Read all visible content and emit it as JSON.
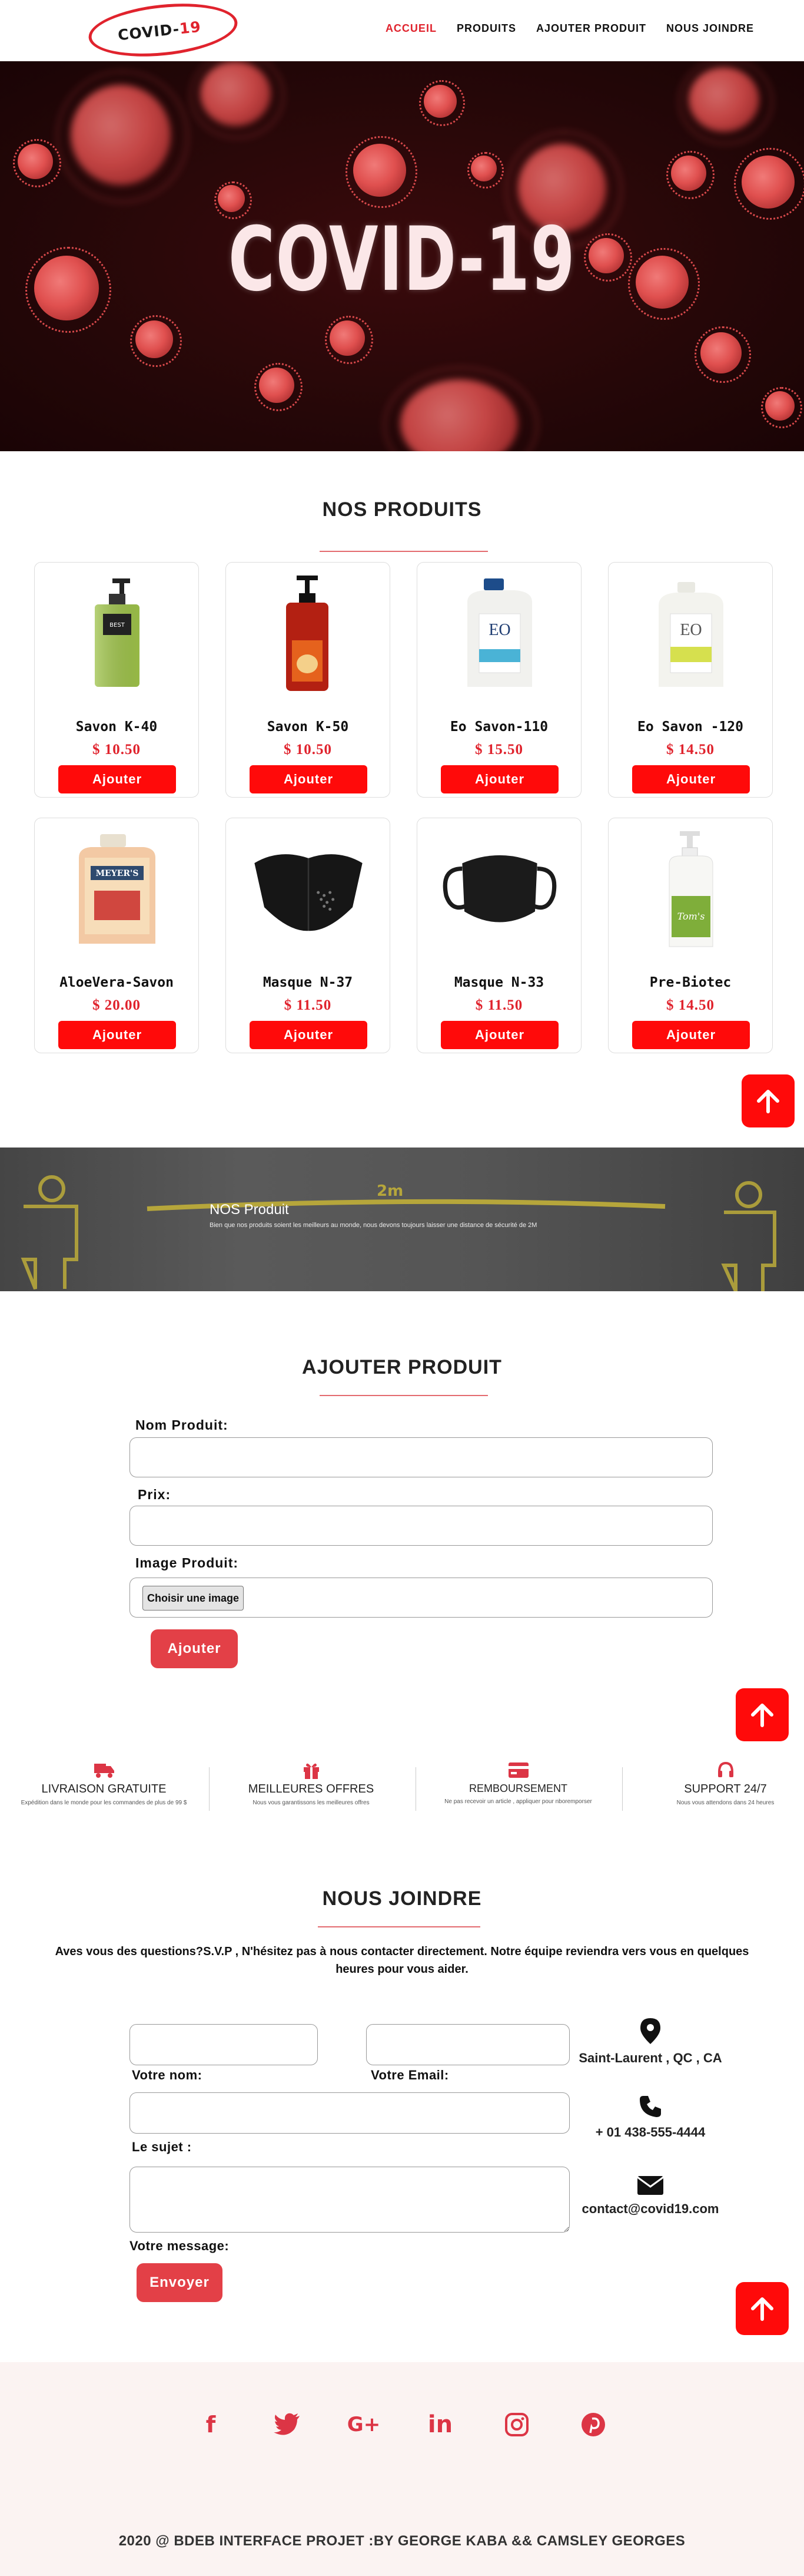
{
  "brand": {
    "logo_text_main": "COVID-",
    "logo_text_accent": "19"
  },
  "nav": {
    "items": [
      {
        "label": "ACCUEIL",
        "active": true
      },
      {
        "label": "PRODUITS",
        "active": false
      },
      {
        "label": "AJOUTER PRODUIT",
        "active": false
      },
      {
        "label": "NOUS JOINDRE",
        "active": false
      }
    ]
  },
  "hero": {
    "title": "COVID-19"
  },
  "products_section": {
    "title": "NOS PRODUITS",
    "add_label": "Ajouter",
    "items": [
      {
        "name": "Savon K-40",
        "price": "$ 10.50",
        "image": "green-soap-pump-bottle"
      },
      {
        "name": "Savon K-50",
        "price": "$ 10.50",
        "image": "red-soap-pump-bottle"
      },
      {
        "name": "Eo Savon-110",
        "price": "$ 15.50",
        "image": "eo-soap-gallon-blue"
      },
      {
        "name": "Eo Savon -120",
        "price": "$ 14.50",
        "image": "eo-soap-gallon-green"
      },
      {
        "name": "AloeVera-Savon",
        "price": "$ 20.00",
        "image": "meyers-soap-jug"
      },
      {
        "name": "Masque N-37",
        "price": "$ 11.50",
        "image": "neoprene-face-mask"
      },
      {
        "name": "Masque N-33",
        "price": "$ 11.50",
        "image": "black-cloth-mask"
      },
      {
        "name": "Pre-Biotec",
        "price": "$ 14.50",
        "image": "toms-soap-pump"
      }
    ]
  },
  "banner": {
    "title": "NOS Produit",
    "subtitle": "Bien que nos produits soient les meilleurs au monde, nous devons toujours laisser une distance de sécurité de 2M",
    "floor_text": "2m"
  },
  "add_product": {
    "title": "AJOUTER PRODUIT",
    "name_label": "Nom Produit:",
    "price_label": "Prix:",
    "image_label": "Image Produit:",
    "file_button": "Choisir une image",
    "submit_label": "Ajouter"
  },
  "features": [
    {
      "icon": "truck-icon",
      "title": "LIVRAISON GRATUITE",
      "desc": "Expédition dans le monde pour les commandes de plus de 99 $"
    },
    {
      "icon": "gift-icon",
      "title": "MEILLEURES OFFRES",
      "desc": "Nous vous garantissons les meilleures offres"
    },
    {
      "icon": "credit-card-icon",
      "title": "REMBOURSEMENT",
      "desc": "Ne pas recevoir un article , appliquer pour nboremporser"
    },
    {
      "icon": "headset-icon",
      "title": "SUPPORT 24/7",
      "desc": "Nous vous attendons dans 24 heures"
    }
  ],
  "contact": {
    "title": "NOUS JOINDRE",
    "intro": "Aves vous des questions?S.V.P , N'hésitez pas à nous contacter directement. Notre équipe reviendra vers vous en quelques heures pour vous aider.",
    "name_label": "Votre nom:",
    "email_label": "Votre Email:",
    "subject_label": "Le sujet :",
    "message_label": "Votre message:",
    "submit_label": "Envoyer",
    "address": "Saint-Laurent , QC , CA",
    "phone": "+ 01 438-555-4444",
    "email": "contact@covid19.com"
  },
  "footer": {
    "socials": [
      "facebook-icon",
      "twitter-icon",
      "google-plus-icon",
      "linkedin-icon",
      "instagram-icon",
      "pinterest-icon"
    ],
    "copyright": "2020 @ BDEB INTERFACE PROJET :BY GEORGE KABA && CAMSLEY GEORGES"
  },
  "colors": {
    "accent": "#e0232d",
    "button_red": "#ff0a0a",
    "soft_red": "#e34047",
    "hero_bg": "#250708"
  }
}
